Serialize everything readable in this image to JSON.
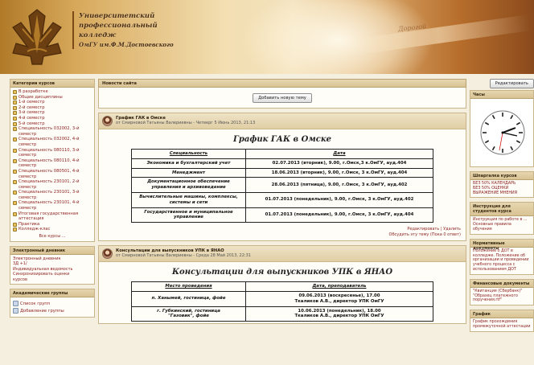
{
  "header": {
    "title_lines": [
      "Университетский",
      "профессиональный",
      "колледж",
      "ОмГУ им.Ф.М.Достоевского"
    ],
    "script_text": "Дорогой"
  },
  "left": {
    "categories": {
      "heading": "Категории курсов",
      "items": [
        "В разработке",
        "Общие дисциплины",
        "1-й семестр",
        "2-й семестр",
        "3-й семестр",
        "4-й семестр",
        "5-й семестр",
        "Специальность 032002, 3-й семестр",
        "Специальность 032002, 4-й семестр",
        "Специальность 080110, 3-й семестр",
        "Специальность 080110, 4-й семестр",
        "Специальность 080501, 4-й семестр",
        "Специальность 230101, 2-й семестр",
        "Специальность 230101, 3-й семестр",
        "Специальность 230101, 4-й семестр",
        "Итоговая государственная аттестация",
        "Практика",
        "Колледж-клас"
      ],
      "all_courses": "Все курсы ..."
    },
    "journal": {
      "heading": "Электронный дневник",
      "links": [
        "Электронный дневник",
        "3Д +1/",
        "Индивидуальная ведомость",
        "Синхронизировать оценки",
        "курсов"
      ]
    },
    "groups": {
      "heading": "Академические группы",
      "items": [
        "Список групп",
        "Добавление группы"
      ]
    }
  },
  "main": {
    "news_heading": "Новости сайта",
    "add_topic_label": "Добавить новую тему",
    "posts": [
      {
        "title": "График ГАК в Омске",
        "meta": "от Смирновой Татьяны Валериевны - Четверг 5 Июнь 2013, 21:13",
        "heading": "График ГАК в Омске",
        "columns": [
          "Специальность",
          "Дата"
        ],
        "rows": [
          [
            "Экономика и бухгалтерский учет",
            "02.07.2013 (вторник), 9.00, г.Омск,3 к.ОмГУ, ауд.404"
          ],
          [
            "Менеджмент",
            "18.06.2013 (вторник), 9.00, г.Омск, 3 к.ОмГУ, ауд.404"
          ],
          [
            "Документационное обеспечение управления и архивоведение",
            "28.06.2013 (пятница), 9.00, г.Омск, 3 к.ОмГУ, ауд.402"
          ],
          [
            "Вычислительные машины, комплексы, системы и сети",
            "01.07.2013 (понедельник), 9.00, г.Омск, 3 к.ОмГУ, ауд.402"
          ],
          [
            "Государственное и муниципальное управление",
            "01.07.2013 (понедельник), 9.00, г.Омск, 3 к.ОмГУ, ауд.404"
          ]
        ],
        "actions": [
          "Редактировать | Удалить",
          "Обсудить эту тему (Пока 0 ответ)"
        ]
      },
      {
        "title": "Консультации для выпускников УПК в ЯНАО",
        "meta": "от Смирновой Татьяны Валериевны - Среда 28 Май 2013, 22:31",
        "heading": "Консультации для выпускников УПК в ЯНАО",
        "columns": [
          "Место проведения",
          "Дата, преподаватель"
        ],
        "rows": [
          [
            "п. Ханымей, гостиница, фойе",
            "09.06.2013 (воскресенье), 17.00\nТкаликов А.В., директор УПК ОмГУ"
          ],
          [
            "г. Губкинский, гостиница\n\"Газовик\", фойе",
            "10.06.2013 (понедельник), 18.00\nТкаликов А.В., директор УПК ОмГУ"
          ]
        ]
      }
    ]
  },
  "right": {
    "edit_label": "Редактировать",
    "clock_heading": "Часы",
    "shortcuts": {
      "heading": "Шпаргалка курсов",
      "links": [
        "БЕЗ 50% КАЛЕНДАРЬ",
        "БЕЗ 50% ОЦЕНКИ",
        "ВЫРАЖЕНИЕ МНЕНИЯ"
      ]
    },
    "instructions": {
      "heading": "Инструкция для студентов курса",
      "text": "Инструкция по работе в ... Основные правила обучения"
    },
    "norm_docs": {
      "heading": "Нормативные документы",
      "text": "Положение о ДОТ в колледже. Положение об организации и проведении учебного процесса с использованием ДОТ"
    },
    "finance": {
      "heading": "Финансовые документы",
      "text": "\"Квитанция (Сбербанк)\" \"Образец платежного поручения.rtf\""
    },
    "schedule": {
      "heading": "График",
      "text": "График прохождения промежуточной аттестации"
    }
  }
}
